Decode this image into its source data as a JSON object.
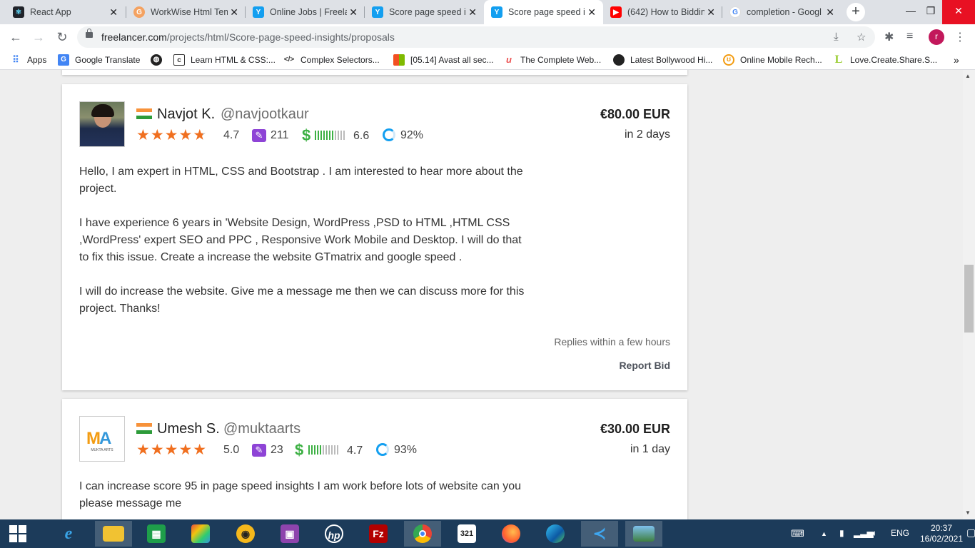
{
  "tabs": [
    {
      "title": "React App",
      "icon": "react-icon",
      "color": "#222"
    },
    {
      "title": "WorkWise Html Tem",
      "icon": "workwise-icon",
      "color": "#e8453c"
    },
    {
      "title": "Online Jobs | Freela",
      "icon": "freelancer-icon",
      "color": "#139ff0"
    },
    {
      "title": "Score page speed in",
      "icon": "freelancer-icon",
      "color": "#139ff0"
    },
    {
      "title": "Score page speed in",
      "icon": "freelancer-icon",
      "color": "#139ff0"
    },
    {
      "title": "(642) How to Biddin",
      "icon": "youtube-icon",
      "color": "#ff0000"
    },
    {
      "title": "completion - Googl",
      "icon": "google-icon",
      "color": "#4285f4"
    }
  ],
  "address_bar": {
    "domain": "freelancer.com",
    "path": "/projects/html/Score-page-speed-insights/proposals"
  },
  "profile_initial": "r",
  "bookmarks": [
    {
      "label": "Apps",
      "icon": "apps-grid-icon"
    },
    {
      "label": "Google Translate",
      "icon": "google-translate-icon"
    },
    {
      "label": "",
      "icon": "globe-icon"
    },
    {
      "label": "Learn HTML & CSS:...",
      "icon": "codecademy-icon"
    },
    {
      "label": "Complex Selectors...",
      "icon": "code-icon"
    },
    {
      "label": "[05.14] Avast all sec...",
      "icon": "avast-icon"
    },
    {
      "label": "The Complete Web...",
      "icon": "udemy-icon"
    },
    {
      "label": "Latest Bollywood Hi...",
      "icon": "music-icon"
    },
    {
      "label": "Online Mobile Rech...",
      "icon": "recharge-icon"
    },
    {
      "label": "Love.Create.Share.S...",
      "icon": "l-icon"
    }
  ],
  "bids": [
    {
      "name": "Navjot K.",
      "handle": "@navjootkaur",
      "rating": "4.7",
      "reviews": "211",
      "earnings_score": "6.6",
      "earnings_level": 0.65,
      "completion": "92%",
      "price": "€80.00 EUR",
      "delivery": "in 2 days",
      "paragraphs": [
        "Hello, I am expert in HTML, CSS and Bootstrap . I am interested to hear more about the project.",
        "I have experience 6 years in 'Website Design, WordPress ,PSD to HTML ,HTML CSS ,WordPress' expert SEO and PPC , Responsive Work Mobile and Desktop. I will do that to fix this issue. Create a increase the website GTmatrix and google speed .",
        "I will do increase the website. Give me a message me then we can discuss more for this project. Thanks!"
      ],
      "replies": "Replies within a few hours",
      "report": "Report Bid"
    },
    {
      "name": "Umesh S.",
      "handle": "@muktaarts",
      "rating": "5.0",
      "reviews": "23",
      "earnings_score": "4.7",
      "earnings_level": 0.45,
      "completion": "93%",
      "price": "€30.00 EUR",
      "delivery": "in 1 day",
      "paragraphs": [
        "I can increase score 95 in page speed insights I am work before lots of website can you please message me"
      ],
      "logo_text": "MUKTA ARTS"
    }
  ],
  "system_tray": {
    "language": "ENG",
    "time": "20:37",
    "date": "16/02/2021"
  }
}
